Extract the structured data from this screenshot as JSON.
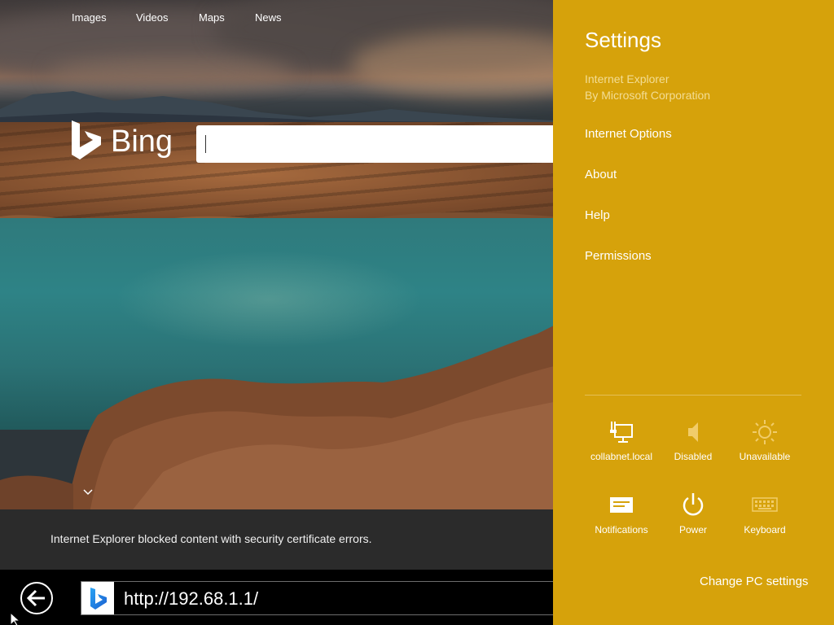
{
  "browser": {
    "top_nav": [
      "Images",
      "Videos",
      "Maps",
      "News"
    ],
    "logo_text": "Bing",
    "search": {
      "value": ""
    },
    "infobar_message": "Internet Explorer blocked content with security certificate errors.",
    "address_bar": {
      "url": "http://192.68.1.1/"
    }
  },
  "settings_charm": {
    "title": "Settings",
    "app_name": "Internet Explorer",
    "app_publisher": "By Microsoft Corporation",
    "items": [
      "Internet Options",
      "About",
      "Help",
      "Permissions"
    ],
    "quick_settings": [
      {
        "label": "collabnet.local",
        "icon": "network-icon"
      },
      {
        "label": "Disabled",
        "icon": "volume-icon"
      },
      {
        "label": "Unavailable",
        "icon": "brightness-icon"
      },
      {
        "label": "Notifications",
        "icon": "notifications-icon"
      },
      {
        "label": "Power",
        "icon": "power-icon"
      },
      {
        "label": "Keyboard",
        "icon": "keyboard-icon"
      }
    ],
    "footer_link": "Change PC settings"
  },
  "colors": {
    "charm_background": "#d6a20b",
    "charm_subtext": "#f3dd95",
    "infobar_background": "#2b2b2b"
  }
}
